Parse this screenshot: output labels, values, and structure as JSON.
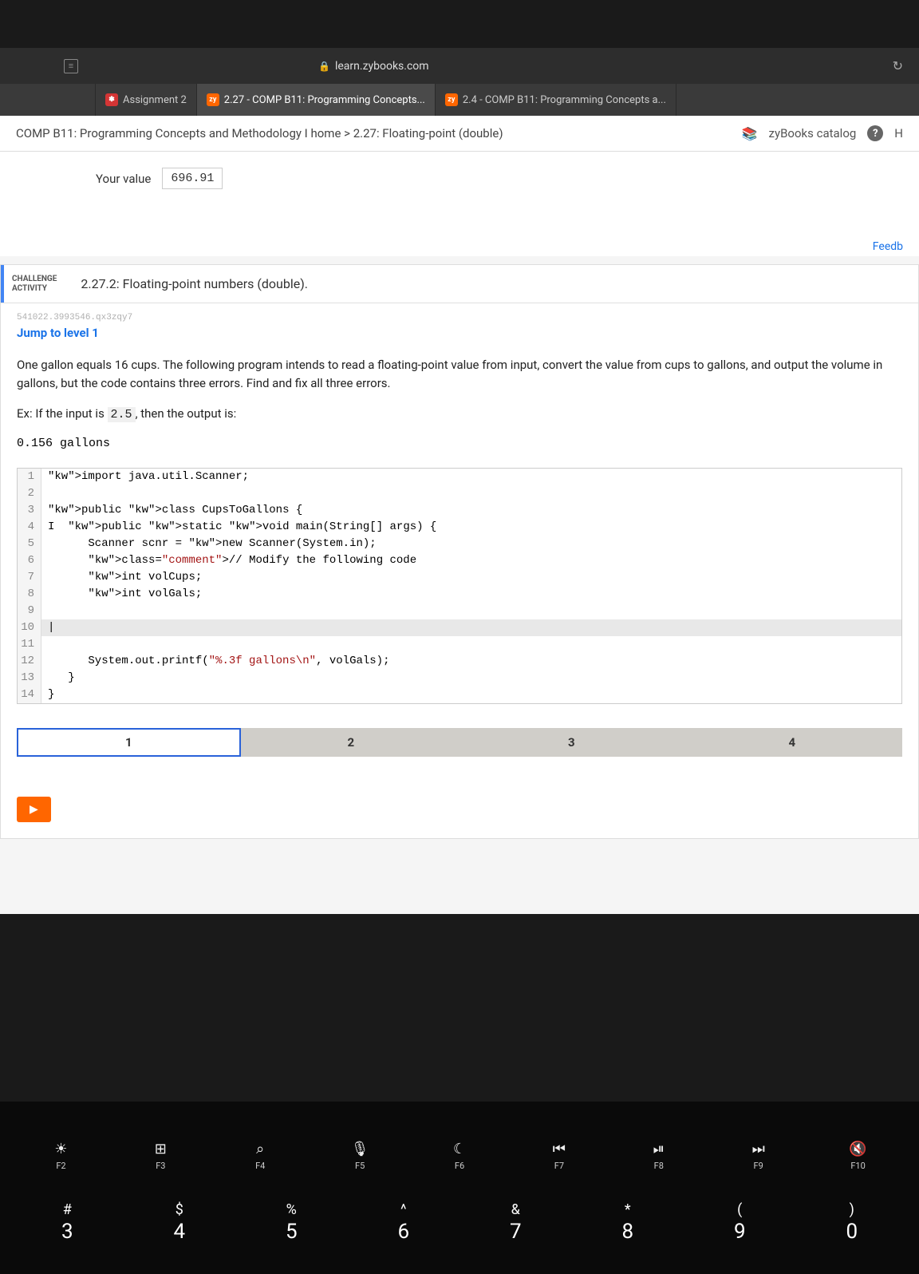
{
  "url": "learn.zybooks.com",
  "tabs": [
    {
      "label": "Assignment 2",
      "iconText": "",
      "iconClass": "canvas"
    },
    {
      "label": "2.27 - COMP B11: Programming Concepts...",
      "iconText": "zy",
      "iconClass": ""
    },
    {
      "label": "2.4 - COMP B11: Programming Concepts a...",
      "iconText": "zy",
      "iconClass": ""
    }
  ],
  "breadcrumb": "COMP B11: Programming Concepts and Methodology I home > 2.27: Floating-point (double)",
  "catalog_label": "zyBooks catalog",
  "help_text": "H",
  "your_value": {
    "label": "Your value",
    "value": "696.91"
  },
  "feedback_label": "Feedb",
  "challenge": {
    "tag_line1": "CHALLENGE",
    "tag_line2": "ACTIVITY",
    "number_title": "2.27.2: Floating-point numbers (double).",
    "section_id": "541022.3993546.qx3zqy7",
    "jump_link": "Jump to level 1",
    "problem_p1": "One gallon equals 16 cups. The following program intends to read a floating-point value from input, convert the value from cups to gallons, and output the volume in gallons, but the code contains three errors. Find and fix all three errors.",
    "problem_p2_prefix": "Ex: If the input is ",
    "problem_p2_code": "2.5",
    "problem_p2_suffix": ", then the output is:",
    "example_output": "0.156 gallons"
  },
  "code_lines": [
    {
      "n": "1",
      "content": "import java.util.Scanner;",
      "highlight": false
    },
    {
      "n": "2",
      "content": "",
      "highlight": false
    },
    {
      "n": "3",
      "content": "public class CupsToGallons {",
      "highlight": false
    },
    {
      "n": "4",
      "content": "   public static void main(String[] args) {",
      "highlight": false,
      "cursor": true
    },
    {
      "n": "5",
      "content": "      Scanner scnr = new Scanner(System.in);",
      "highlight": false
    },
    {
      "n": "6",
      "content": "      // Modify the following code",
      "highlight": false
    },
    {
      "n": "7",
      "content": "      int volCups;",
      "highlight": false
    },
    {
      "n": "8",
      "content": "      int volGals;",
      "highlight": false
    },
    {
      "n": "9",
      "content": "",
      "highlight": false
    },
    {
      "n": "10",
      "content": "|",
      "highlight": true
    },
    {
      "n": "11",
      "content": "",
      "highlight": false
    },
    {
      "n": "12",
      "content": "      System.out.printf(\"%.3f gallons\\n\", volGals);",
      "highlight": false
    },
    {
      "n": "13",
      "content": "   }",
      "highlight": false
    },
    {
      "n": "14",
      "content": "}",
      "highlight": false
    }
  ],
  "levels": [
    "1",
    "2",
    "3",
    "4"
  ],
  "active_level": 0,
  "fn_keys": [
    {
      "icon": "☼",
      "label": "F2"
    },
    {
      "icon": "⌨",
      "label": "F3",
      "iconText": "⊞□"
    },
    {
      "icon": "🔍",
      "label": "F4"
    },
    {
      "icon": "🎤",
      "label": "F5"
    },
    {
      "icon": "☾",
      "label": "F6"
    },
    {
      "icon": "◃◃",
      "label": "F7"
    },
    {
      "icon": "▷II",
      "label": "F8"
    },
    {
      "icon": "▷▷",
      "label": "F9"
    },
    {
      "icon": "◁",
      "label": "F10",
      "iconStyle": "transform:scaleX(-1)"
    }
  ],
  "num_keys": [
    {
      "sym": "#",
      "num": "3"
    },
    {
      "sym": "$",
      "num": "4"
    },
    {
      "sym": "%",
      "num": "5"
    },
    {
      "sym": "^",
      "num": "6"
    },
    {
      "sym": "&",
      "num": "7"
    },
    {
      "sym": "*",
      "num": "8"
    },
    {
      "sym": "(",
      "num": "9"
    },
    {
      "sym": ")",
      "num": "0"
    }
  ]
}
